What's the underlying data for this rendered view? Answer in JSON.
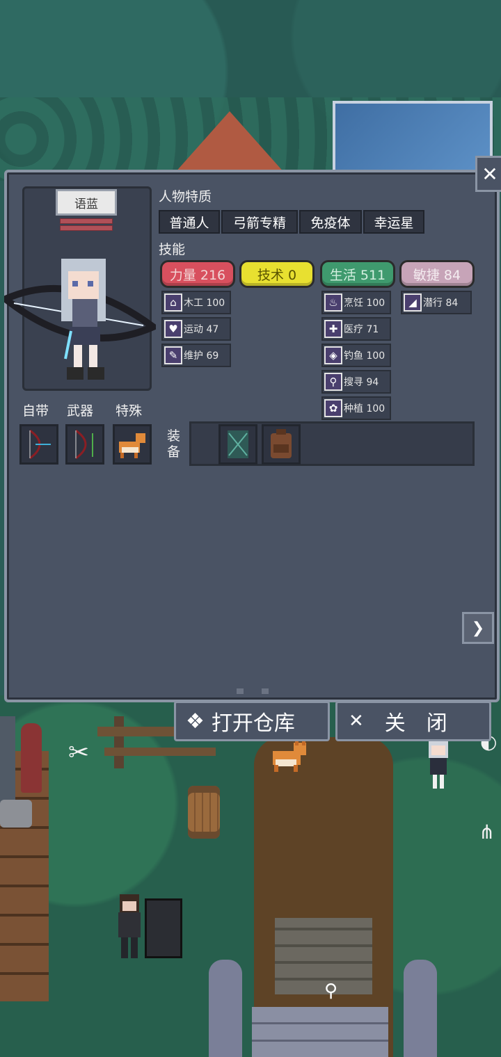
{
  "character": {
    "name": "语蓝"
  },
  "sections": {
    "traits_title": "人物特质",
    "skills_title": "技能"
  },
  "traits": [
    "普通人",
    "弓箭专精",
    "免疫体",
    "幸运星"
  ],
  "skills": [
    {
      "label": "力量 216",
      "color": "#d8505e",
      "text_color": "#f2d6d6"
    },
    {
      "label": "技术 0",
      "color": "#e8e030",
      "text_color": "#5a5400"
    },
    {
      "label": "生活 511",
      "color": "#3f9a6e",
      "text_color": "#d4efe0"
    },
    {
      "label": "敏捷 84",
      "color": "#c7a4b8",
      "text_color": "#f4ecf0"
    }
  ],
  "sub_skills": {
    "strength": [
      {
        "icon": "house-icon",
        "glyph": "⌂",
        "label": "木工 100"
      },
      {
        "icon": "heart-icon",
        "glyph": "♥",
        "label": "运动 47"
      },
      {
        "icon": "wrench-icon",
        "glyph": "✎",
        "label": "维护 69"
      }
    ],
    "life": [
      {
        "icon": "cooking-pot-icon",
        "glyph": "♨",
        "label": "烹饪 100"
      },
      {
        "icon": "medkit-icon",
        "glyph": "✚",
        "label": "医疗 71"
      },
      {
        "icon": "fish-icon",
        "glyph": "◈",
        "label": "钓鱼 100"
      },
      {
        "icon": "magnifier-icon",
        "glyph": "⚲",
        "label": "搜寻 94"
      },
      {
        "icon": "plant-icon",
        "glyph": "✿",
        "label": "种植 100"
      }
    ],
    "agility": [
      {
        "icon": "sneak-icon",
        "glyph": "◢",
        "label": "潜行 84"
      }
    ]
  },
  "slots": {
    "innate_label": "自带",
    "weapon_label": "武器",
    "special_label": "特殊",
    "equip_label": "装备"
  },
  "buttons": {
    "open_warehouse": "打开仓库",
    "close": "关　闭"
  }
}
